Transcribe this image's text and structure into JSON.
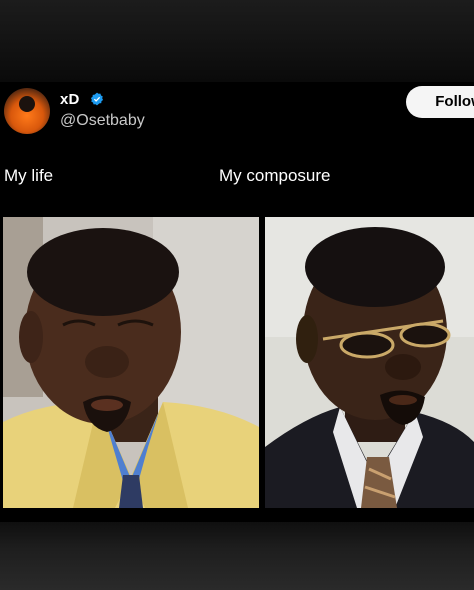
{
  "post": {
    "display_name": "xD",
    "handle": "@Osetbaby",
    "follow_label": "Follow",
    "verified": true,
    "avatar_icon": "orange-hoodie-avatar"
  },
  "meme": {
    "left_caption": "My life",
    "right_caption": "My composure",
    "left_image": "man-crying-yellow-suit",
    "right_image": "man-composed-sunglasses-suit"
  },
  "colors": {
    "background": "#000000",
    "follow_button": "#f5f5f5",
    "verified_badge": "#1d9bf0"
  }
}
